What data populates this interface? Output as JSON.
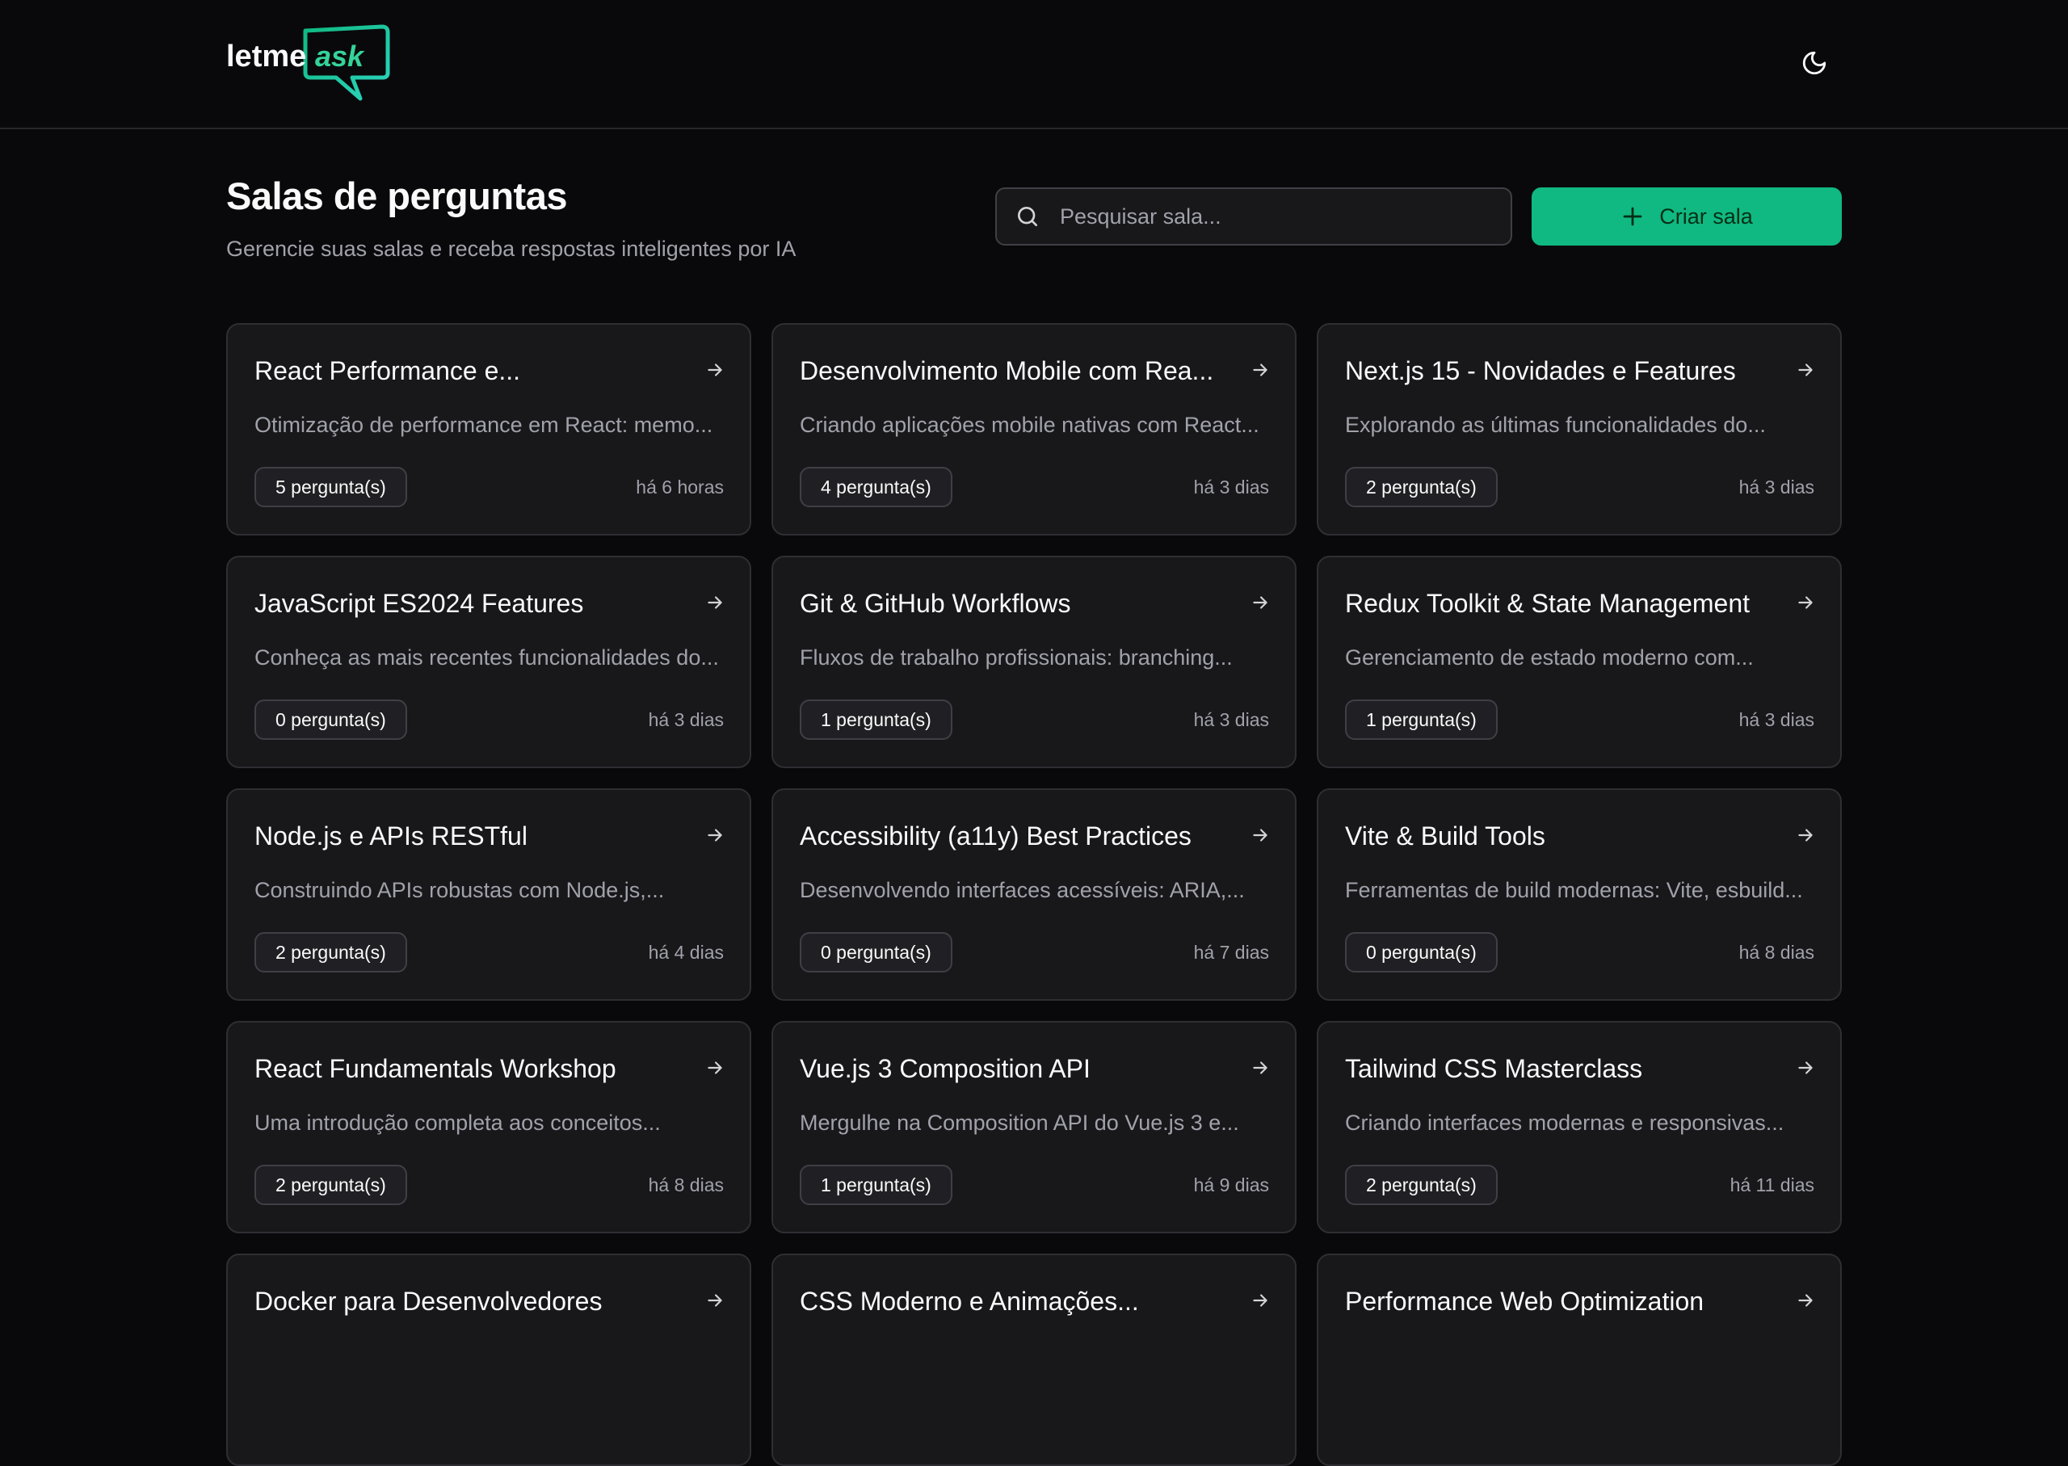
{
  "header": {
    "logo": {
      "part1": "letme",
      "part2": "ask"
    },
    "theme_toggle_icon": "moon-icon"
  },
  "main": {
    "title": "Salas de perguntas",
    "subtitle": "Gerencie suas salas e receba respostas inteligentes por IA",
    "search": {
      "placeholder": "Pesquisar sala...",
      "value": "",
      "icon": "search-icon"
    },
    "create_button": {
      "label": "Criar sala",
      "icon": "plus-icon"
    }
  },
  "colors": {
    "background": "#09090b",
    "card": "#18181b",
    "border": "#2e2e33",
    "accent": "#10b981",
    "text": "#fafafa",
    "muted": "#a1a1aa"
  },
  "rooms": [
    {
      "title": "React Performance e...",
      "description": "Otimização de performance em React: memo...",
      "questions": "5 pergunta(s)",
      "time": "há 6 horas"
    },
    {
      "title": "Desenvolvimento Mobile com Rea...",
      "description": "Criando aplicações mobile nativas com React...",
      "questions": "4 pergunta(s)",
      "time": "há 3 dias"
    },
    {
      "title": "Next.js 15 - Novidades e Features",
      "description": "Explorando as últimas funcionalidades do...",
      "questions": "2 pergunta(s)",
      "time": "há 3 dias"
    },
    {
      "title": "JavaScript ES2024 Features",
      "description": "Conheça as mais recentes funcionalidades do...",
      "questions": "0 pergunta(s)",
      "time": "há 3 dias"
    },
    {
      "title": "Git & GitHub Workflows",
      "description": "Fluxos de trabalho profissionais: branching...",
      "questions": "1 pergunta(s)",
      "time": "há 3 dias"
    },
    {
      "title": "Redux Toolkit & State Management",
      "description": "Gerenciamento de estado moderno com...",
      "questions": "1 pergunta(s)",
      "time": "há 3 dias"
    },
    {
      "title": "Node.js e APIs RESTful",
      "description": "Construindo APIs robustas com Node.js,...",
      "questions": "2 pergunta(s)",
      "time": "há 4 dias"
    },
    {
      "title": "Accessibility (a11y) Best Practices",
      "description": "Desenvolvendo interfaces acessíveis: ARIA,...",
      "questions": "0 pergunta(s)",
      "time": "há 7 dias"
    },
    {
      "title": "Vite & Build Tools",
      "description": "Ferramentas de build modernas: Vite, esbuild...",
      "questions": "0 pergunta(s)",
      "time": "há 8 dias"
    },
    {
      "title": "React Fundamentals Workshop",
      "description": "Uma introdução completa aos conceitos...",
      "questions": "2 pergunta(s)",
      "time": "há 8 dias"
    },
    {
      "title": "Vue.js 3 Composition API",
      "description": "Mergulhe na Composition API do Vue.js 3 e...",
      "questions": "1 pergunta(s)",
      "time": "há 9 dias"
    },
    {
      "title": "Tailwind CSS Masterclass",
      "description": "Criando interfaces modernas e responsivas...",
      "questions": "2 pergunta(s)",
      "time": "há 11 dias"
    },
    {
      "title": "Docker para Desenvolvedores",
      "description": "",
      "questions": "",
      "time": ""
    },
    {
      "title": "CSS Moderno e Animações...",
      "description": "",
      "questions": "",
      "time": ""
    },
    {
      "title": "Performance Web Optimization",
      "description": "",
      "questions": "",
      "time": ""
    }
  ]
}
